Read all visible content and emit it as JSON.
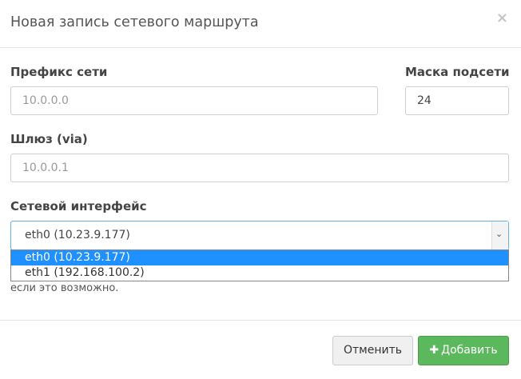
{
  "dialog": {
    "title": "Новая запись сетевого маршрута",
    "close_symbol": "×"
  },
  "form": {
    "prefix_label": "Префикс сети",
    "prefix_placeholder": "10.0.0.0",
    "mask_label": "Маска подсети",
    "mask_value": "24",
    "gateway_label": "Шлюз (via)",
    "gateway_placeholder": "10.0.0.1",
    "interface_label": "Сетевой интерфейс",
    "interface_selected": "eth0 (10.23.9.177)",
    "interface_options": [
      "eth0 (10.23.9.177)",
      "eth1 (192.168.100.2)"
    ],
    "help_text": "если это возможно."
  },
  "footer": {
    "cancel_label": "Отменить",
    "add_plus": "✚",
    "add_label": "Добавить"
  },
  "colors": {
    "primary_green": "#5cb85c",
    "focus_blue": "#66afe9",
    "selected_option": "#1e90ff"
  }
}
